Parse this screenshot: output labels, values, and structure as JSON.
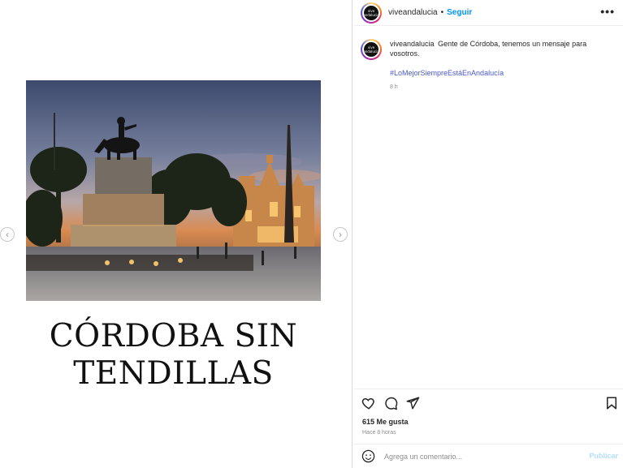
{
  "post": {
    "caption_title_line1": "CÓRDOBA SIN",
    "caption_title_line2": "TENDILLAS",
    "nav_prev": "‹",
    "nav_next": "›"
  },
  "header": {
    "username": "viveandalucia",
    "separator": "•",
    "follow_label": "Seguir",
    "more_label": "•••",
    "avatar_text": "vive andalucia",
    "avatar_icon": "profile-avatar"
  },
  "comment": {
    "username": "viveandalucia",
    "text": "Gente de Córdoba, tenemos un mensaje para vosotros.",
    "hashtag": "#LoMejorSiempreEstáEnAndalucía",
    "time": "8 h"
  },
  "actions": {
    "icons": [
      "heart-icon",
      "comment-icon",
      "share-icon",
      "bookmark-icon"
    ],
    "likes": "615 Me gusta",
    "ago": "Hace 8 horas",
    "comment_placeholder": "Agrega un comentario...",
    "publish_label": "Publicar",
    "emoji_icon": "emoji-icon"
  },
  "colors": {
    "accent": "#0095f6",
    "publish_disabled": "#b2dffc",
    "hashtag": "#4b59c9",
    "muted": "#8e8e8e"
  }
}
